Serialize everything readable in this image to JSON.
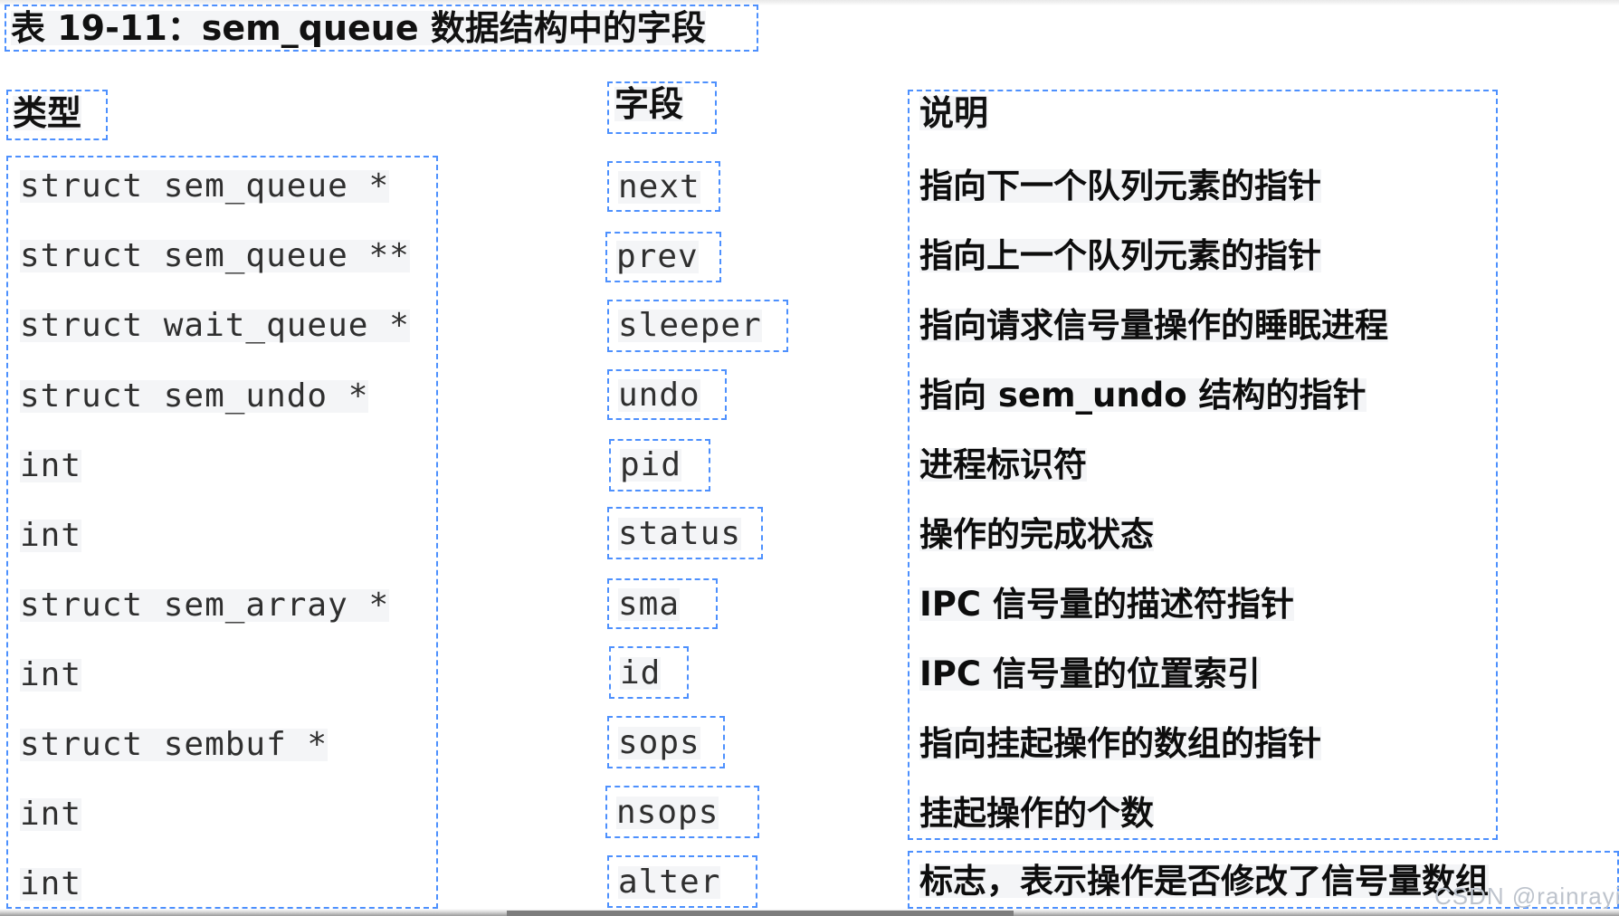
{
  "table": {
    "title": "表 19-11：sem_queue 数据结构中的字段",
    "headers": {
      "type": "类型",
      "field": "字段",
      "description": "说明"
    },
    "rows": [
      {
        "type": "struct sem_queue *",
        "field": "next",
        "description": "指向下一个队列元素的指针"
      },
      {
        "type": "struct sem_queue **",
        "field": "prev",
        "description": "指向上一个队列元素的指针"
      },
      {
        "type": "struct wait_queue *",
        "field": "sleeper",
        "description": "指向请求信号量操作的睡眠进程"
      },
      {
        "type": "struct sem_undo *",
        "field": "undo",
        "description": "指向 sem_undo 结构的指针"
      },
      {
        "type": "int",
        "field": "pid",
        "description": "进程标识符"
      },
      {
        "type": "int",
        "field": "status",
        "description": "操作的完成状态"
      },
      {
        "type": "struct sem_array *",
        "field": "sma",
        "description": "IPC 信号量的描述符指针"
      },
      {
        "type": "int",
        "field": "id",
        "description": "IPC 信号量的位置索引"
      },
      {
        "type": "struct sembuf *",
        "field": "sops",
        "description": "指向挂起操作的数组的指针"
      },
      {
        "type": "int",
        "field": "nsops",
        "description": "挂起操作的个数"
      },
      {
        "type": "int",
        "field": "alter",
        "description": "标志，表示操作是否修改了信号量数组"
      }
    ]
  },
  "watermark": {
    "text": "CSDN @rainrayinrain"
  },
  "colors": {
    "detection_box": "#4d90fe",
    "text": "#111111",
    "mono_text": "#2f2f2f",
    "highlight": "#f4f5f7"
  }
}
